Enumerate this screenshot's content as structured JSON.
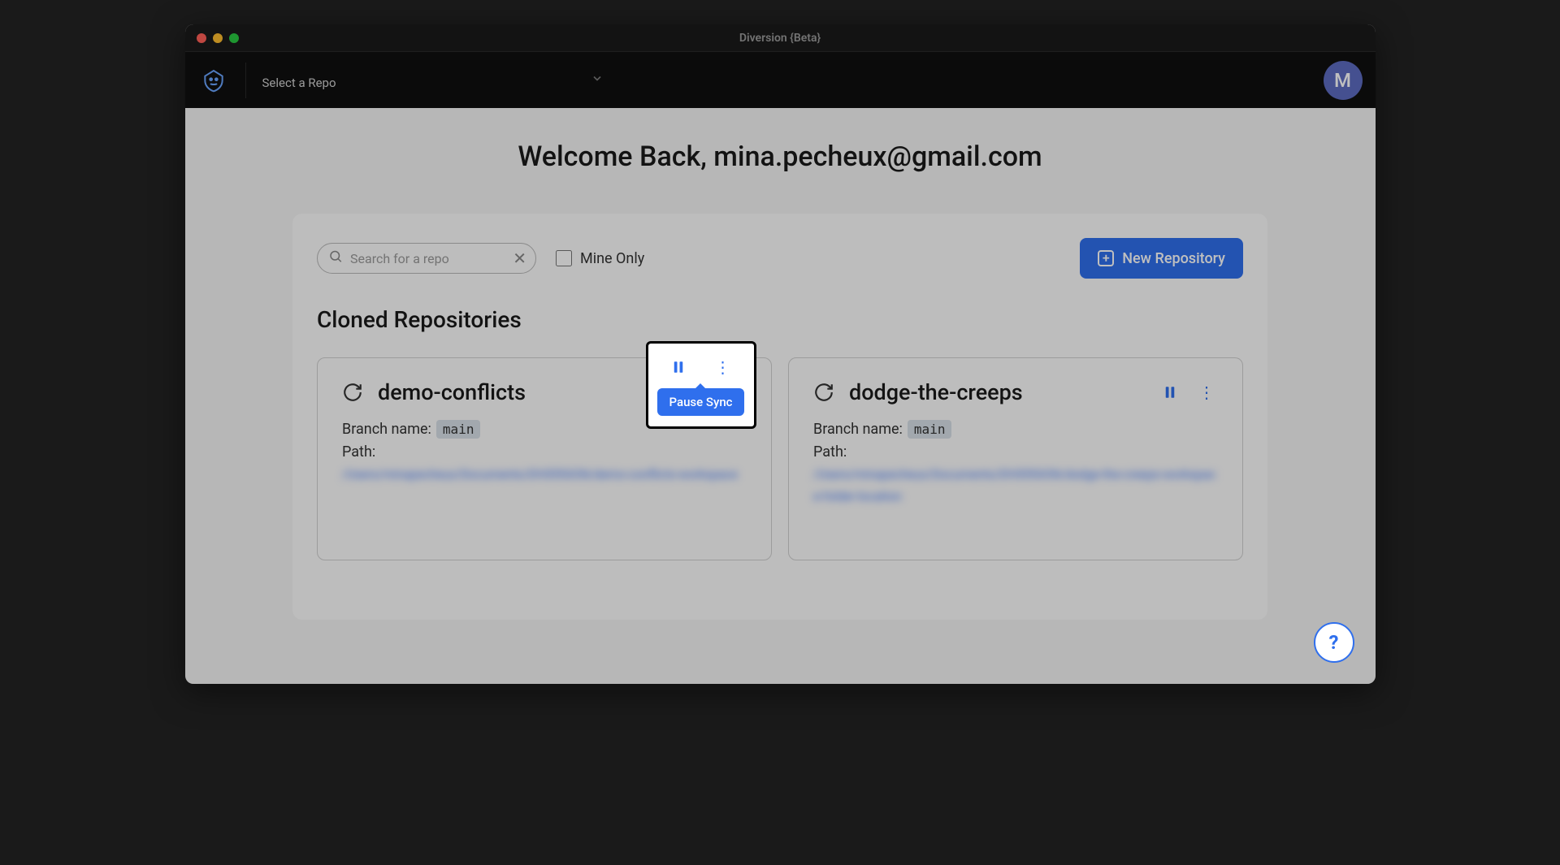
{
  "window": {
    "title": "Diversion {Beta}"
  },
  "topbar": {
    "repo_select_label": "Select a Repo",
    "avatar_letter": "M"
  },
  "main": {
    "welcome_text": "Welcome Back, mina.pecheux@gmail.com",
    "search_placeholder": "Search for a repo",
    "mine_only_label": "Mine Only",
    "new_repo_label": "New Repository",
    "section_title": "Cloned Repositories"
  },
  "tooltip": {
    "text": "Pause Sync"
  },
  "repos": [
    {
      "name": "demo-conflicts",
      "branch_label": "Branch name:",
      "branch": "main",
      "path_label": "Path:",
      "path_text": "/Users/minapecheux/Documents/DIVERSION/demo-conflicts-workspace"
    },
    {
      "name": "dodge-the-creeps",
      "branch_label": "Branch name:",
      "branch": "main",
      "path_label": "Path:",
      "path_text": "/Users/minapecheux/Documents/DIVERSION/dodge-the-creeps-workspace-folder-location"
    }
  ]
}
